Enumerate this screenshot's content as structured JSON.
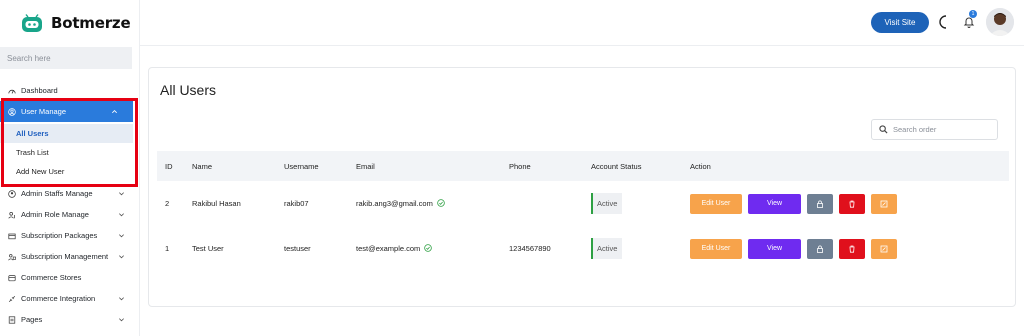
{
  "brand": {
    "name": "Botmerze",
    "logo_icon": "robot-icon",
    "accent": "#19a58a"
  },
  "search": {
    "placeholder": "Search here"
  },
  "sidebar": {
    "items": [
      {
        "label": "Dashboard",
        "icon": "dashboard-icon"
      },
      {
        "label": "User Manage",
        "icon": "user-circle-icon",
        "expanded": true
      },
      {
        "label": "Admin Staffs Manage",
        "icon": "admin-icon"
      },
      {
        "label": "Admin Role Manage",
        "icon": "role-icon"
      },
      {
        "label": "Subscription Packages",
        "icon": "package-icon"
      },
      {
        "label": "Subscription Management",
        "icon": "management-icon"
      },
      {
        "label": "Commerce Stores",
        "icon": "store-icon"
      },
      {
        "label": "Commerce Integration",
        "icon": "integration-icon"
      },
      {
        "label": "Pages",
        "icon": "pages-icon"
      }
    ],
    "submenu": [
      {
        "label": "All Users",
        "current": true
      },
      {
        "label": "Trash List"
      },
      {
        "label": "Add New User"
      }
    ],
    "active_color": "#2a7bdc",
    "highlight_color": "#e60012"
  },
  "topbar": {
    "visit_site": "Visit Site",
    "notification_count": "1",
    "theme_icon": "moon-icon",
    "bell_icon": "bell-icon"
  },
  "main": {
    "title": "All Users",
    "search_placeholder": "Search order",
    "columns": [
      "ID",
      "Name",
      "Username",
      "Email",
      "Phone",
      "Account Status",
      "Action"
    ],
    "rows": [
      {
        "id": "2",
        "name": "Rakibul Hasan",
        "username": "rakib07",
        "email": "rakib.ang3@gmail.com",
        "phone": "",
        "status": "Active"
      },
      {
        "id": "1",
        "name": "Test User",
        "username": "testuser",
        "email": "test@example.com",
        "phone": "1234567890",
        "status": "Active"
      }
    ],
    "actions": {
      "edit": "Edit User",
      "view": "View"
    }
  }
}
